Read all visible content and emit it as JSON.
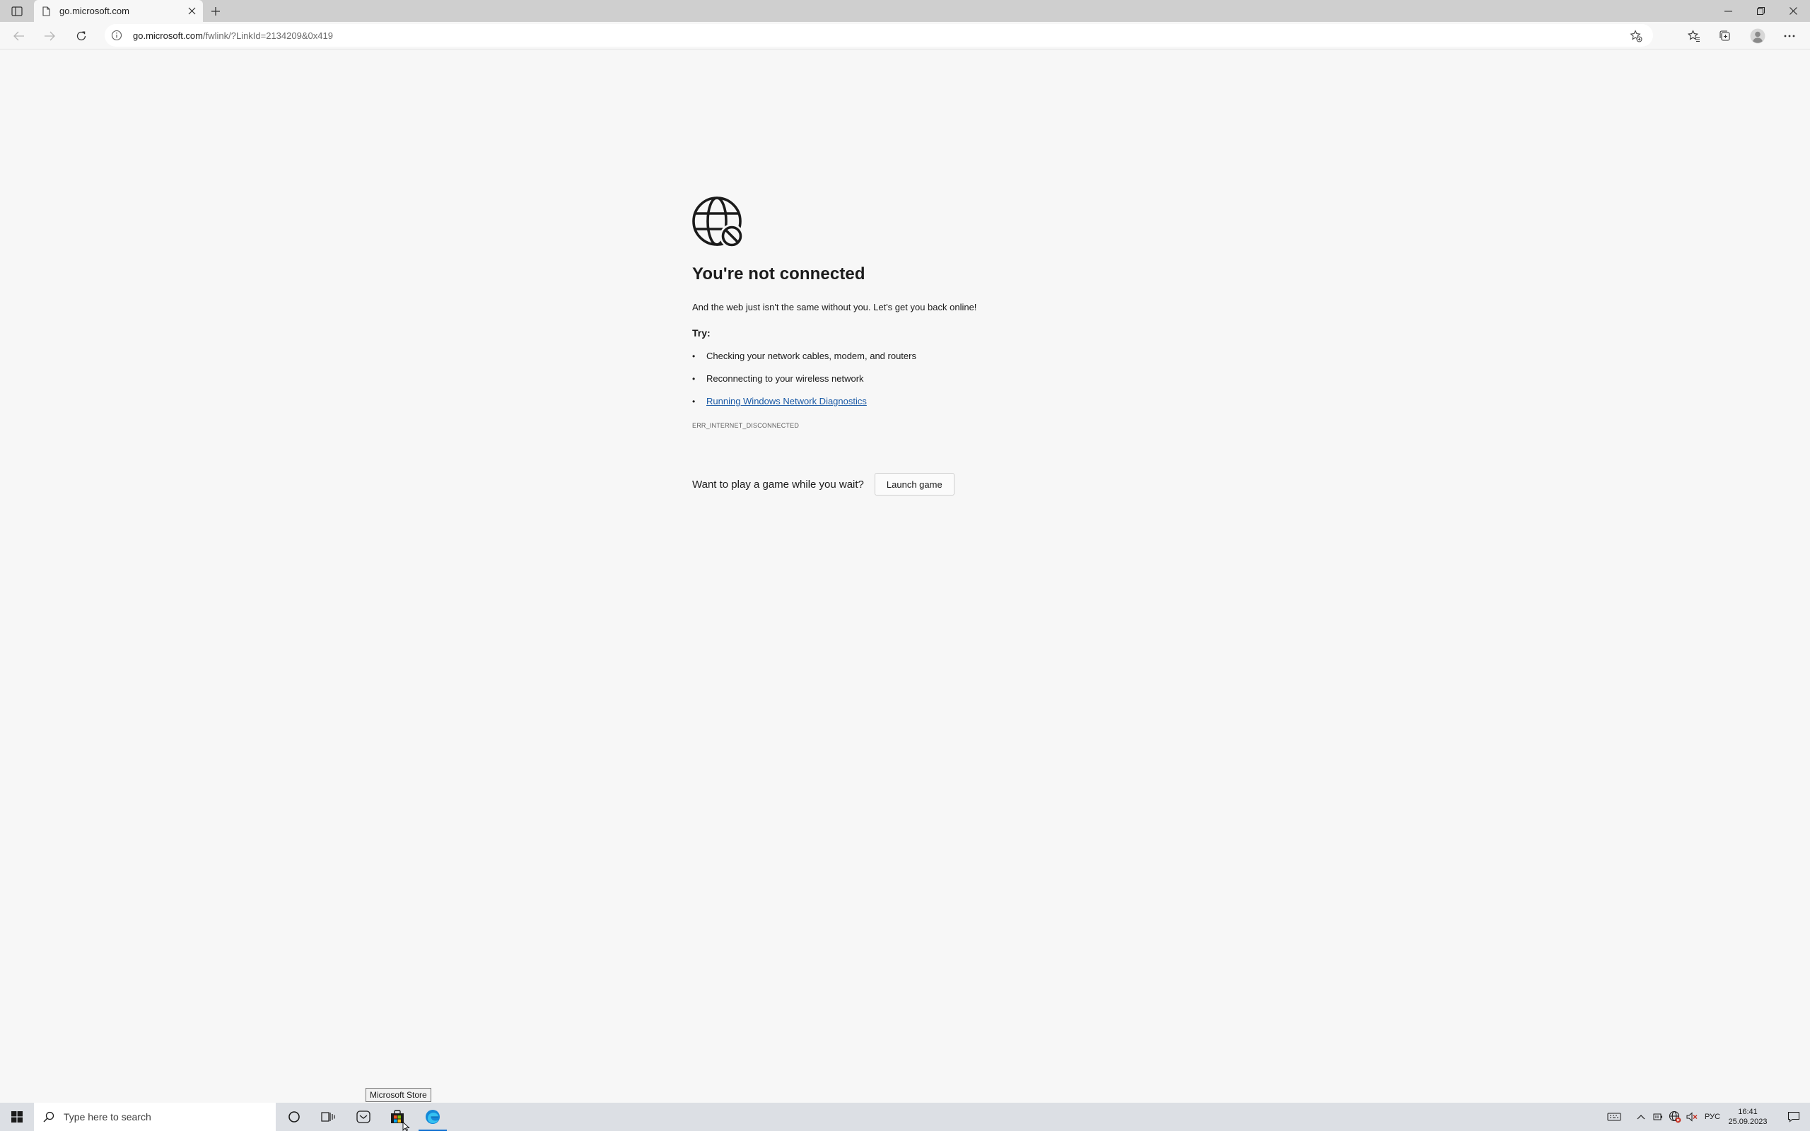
{
  "browser": {
    "tab": {
      "title": "go.microsoft.com"
    },
    "address_bar": {
      "host": "go.microsoft.com",
      "path": "/fwlink/?LinkId=2134209&0x419"
    }
  },
  "page": {
    "title": "You're not connected",
    "subtitle": "And the web just isn't the same without you. Let's get you back online!",
    "try_label": "Try:",
    "suggestions": [
      "Checking your network cables, modem, and routers",
      "Reconnecting to your wireless network",
      "Running Windows Network Diagnostics"
    ],
    "error_code": "ERR_INTERNET_DISCONNECTED",
    "game_prompt": "Want to play a game while you wait?",
    "launch_button": "Launch game"
  },
  "tooltip": {
    "text": "Microsoft Store"
  },
  "taskbar": {
    "search_placeholder": "Type here to search",
    "language": "РУС",
    "time": "16:41",
    "date": "25.09.2023"
  },
  "colors": {
    "accent": "#0e6fd0",
    "link": "#1a5aa6",
    "page_background": "#f7f7f7",
    "tabstrip": "#cfcfcf",
    "taskbar": "#dcdfe4"
  }
}
